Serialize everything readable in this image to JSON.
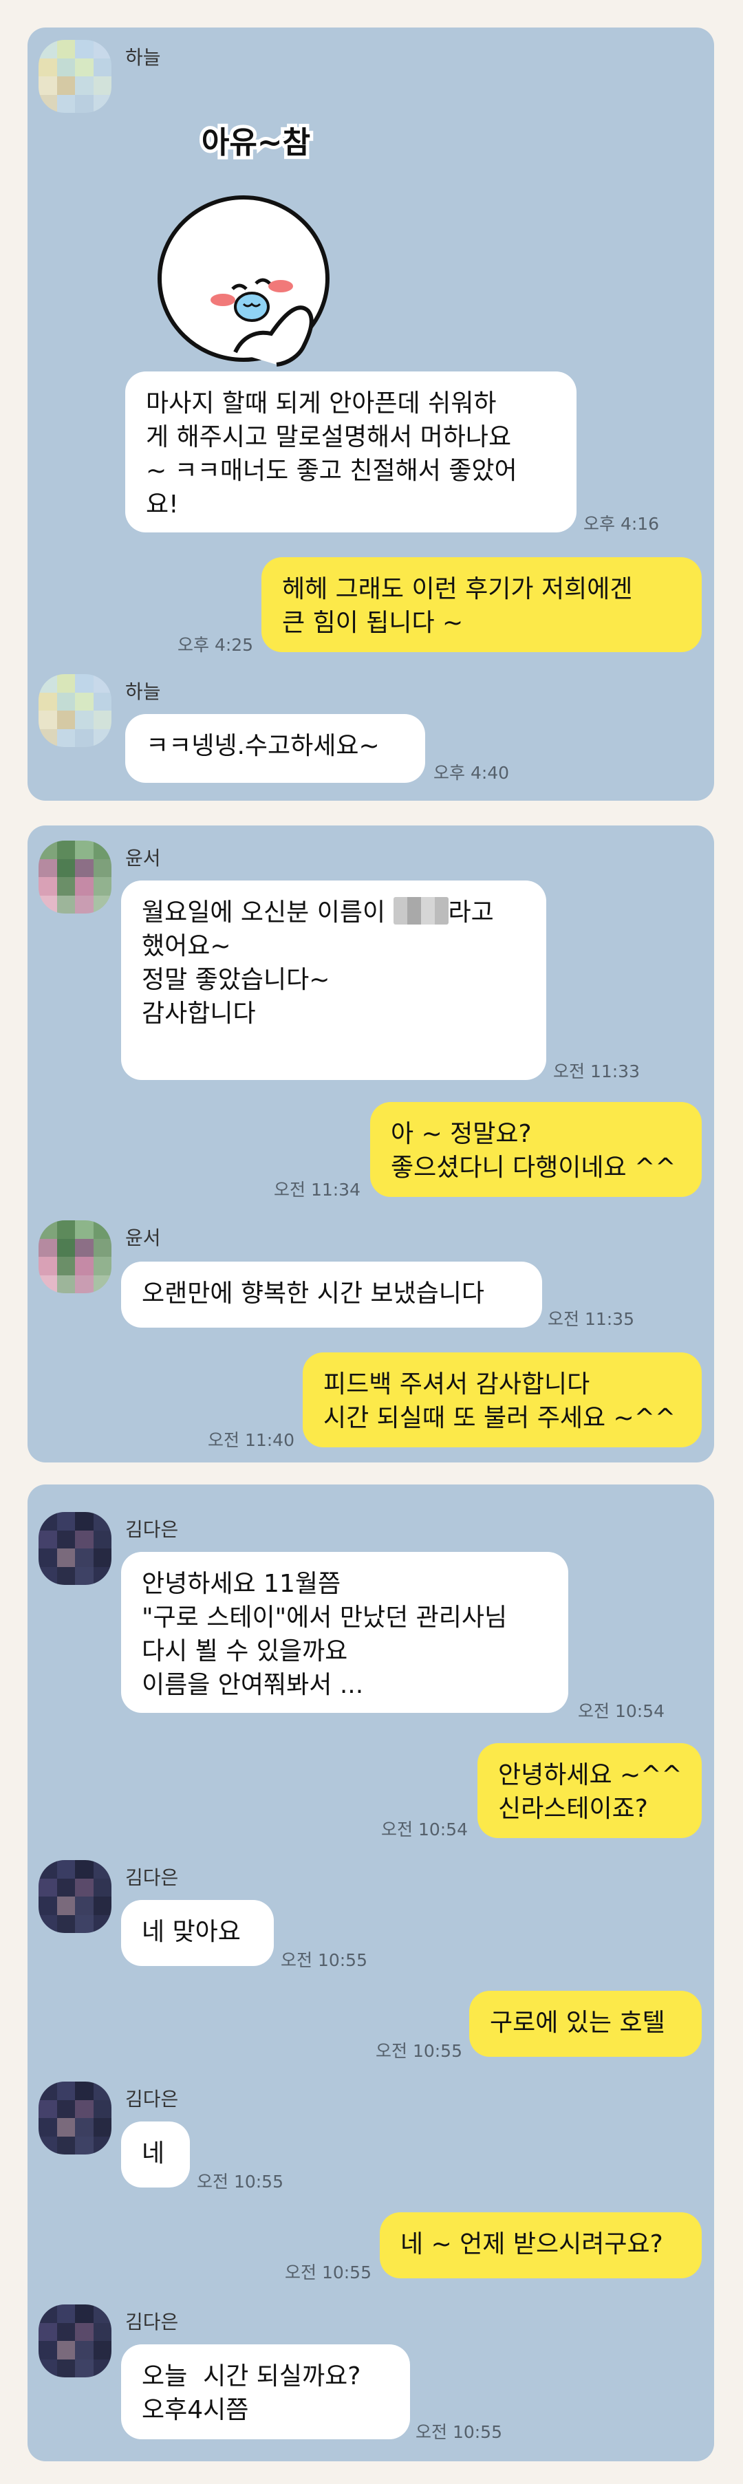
{
  "panels": [
    {
      "contact": "하늘",
      "sticker_caption": "아유~참",
      "messages": [
        {
          "text": "마사지 할때 되게 안아픈데 쉬워하\n게 해주시고 말로설명해서 머하나요\n~ ㅋㅋ매너도 좋고 친절해서 좋았어\n요!",
          "time": "오후 4:16"
        },
        {
          "text": "헤헤 그래도 이런 후기가 저희에겐\n큰 힘이 됩니다 ~",
          "time": "오후 4:25"
        },
        {
          "text": "ㅋㅋ넹넹.수고하세요~",
          "time": "오후 4:40"
        }
      ]
    },
    {
      "contact": "윤서",
      "messages": [
        {
          "text_before": "월요일에 오신분 이름이 ",
          "text_after": "라고\n했어요~\n정말 좋았습니다~\n감사합니다",
          "time": "오전 11:33"
        },
        {
          "text": "아 ~ 정말요?\n좋으셨다니 다행이네요 ^^",
          "time": "오전 11:34"
        },
        {
          "text": "오랜만에 향복한 시간 보냈습니다",
          "time": "오전 11:35"
        },
        {
          "text": "피드백 주셔서 감사합니다\n시간 되실때 또 불러 주세요 ~^^",
          "time": "오전 11:40"
        }
      ]
    },
    {
      "contact": "김다은",
      "messages": [
        {
          "text": "안녕하세요 11월쯤\n\"구로 스테이\"에서 만났던 관리사님\n다시 뵐 수 있을까요\n이름을 안여쭤봐서 ...",
          "time": "오전 10:54"
        },
        {
          "text": "안녕하세요 ~^^\n신라스테이죠?",
          "time": "오전 10:54"
        },
        {
          "text": "네 맞아요",
          "time": "오전 10:55"
        },
        {
          "text": "구로에 있는 호텔",
          "time": "오전 10:55"
        },
        {
          "text": "네",
          "time": "오전 10:55"
        },
        {
          "text": "네 ~ 언제 받으시려구요?",
          "time": "오전 10:55"
        },
        {
          "text": "오늘  시간 되실까요?\n오후4시쯤",
          "time": "오전 10:55"
        }
      ]
    }
  ],
  "colors": {
    "panel_bg": "#b2c7da",
    "incoming_bubble": "#ffffff",
    "outgoing_bubble": "#fce94a",
    "page_bg": "#f6f2ec"
  },
  "icons": [
    "contact-avatar-icon",
    "emoticon-sticker-icon"
  ]
}
